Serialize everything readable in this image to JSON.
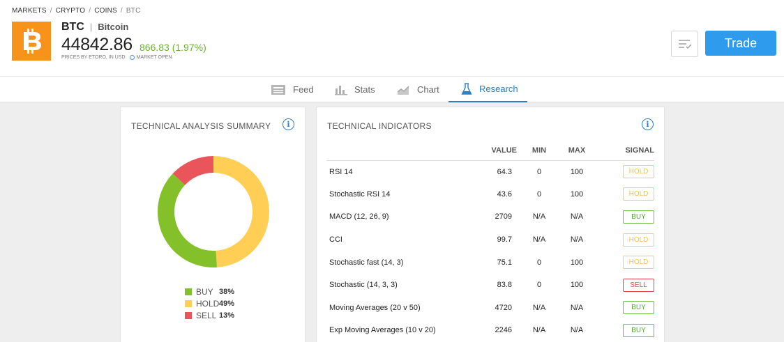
{
  "breadcrumb": [
    "MARKETS",
    "CRYPTO",
    "COINS",
    "BTC"
  ],
  "asset": {
    "symbol": "BTC",
    "name": "Bitcoin",
    "price": "44842.86",
    "change": "866.83 (1.97%)",
    "price_note": "PRICES BY ETORO, IN USD",
    "market_status": "MARKET OPEN",
    "logo_glyph": "₿",
    "logo_color": "#f7931a"
  },
  "actions": {
    "trade_label": "Trade",
    "watch_icon": "list-check-icon"
  },
  "tabs": [
    {
      "label": "Feed",
      "icon": "feed-icon",
      "active": false
    },
    {
      "label": "Stats",
      "icon": "bar-chart-icon",
      "active": false
    },
    {
      "label": "Chart",
      "icon": "line-chart-icon",
      "active": false
    },
    {
      "label": "Research",
      "icon": "flask-icon",
      "active": true
    }
  ],
  "summary": {
    "title": "TECHNICAL ANALYSIS SUMMARY",
    "legend": [
      {
        "label": "BUY",
        "pct": "38%",
        "color": "#83c02a"
      },
      {
        "label": "HOLD",
        "pct": "49%",
        "color": "#ffce54"
      },
      {
        "label": "SELL",
        "pct": "13%",
        "color": "#e9555b"
      }
    ]
  },
  "chart_data": {
    "type": "pie",
    "donut": true,
    "categories": [
      "HOLD",
      "BUY",
      "SELL"
    ],
    "values": [
      49,
      38,
      13
    ],
    "colors": [
      "#ffce54",
      "#83c02a",
      "#e9555b"
    ]
  },
  "indicators": {
    "title": "TECHNICAL INDICATORS",
    "headers": {
      "value": "VALUE",
      "min": "MIN",
      "max": "MAX",
      "signal": "SIGNAL"
    },
    "rows": [
      {
        "name": "RSI 14",
        "value": "64.3",
        "min": "0",
        "max": "100",
        "signal": "HOLD"
      },
      {
        "name": "Stochastic RSI 14",
        "value": "43.6",
        "min": "0",
        "max": "100",
        "signal": "HOLD"
      },
      {
        "name": "MACD (12, 26, 9)",
        "value": "2709",
        "min": "N/A",
        "max": "N/A",
        "signal": "BUY"
      },
      {
        "name": "CCI",
        "value": "99.7",
        "min": "N/A",
        "max": "N/A",
        "signal": "HOLD"
      },
      {
        "name": "Stochastic fast (14, 3)",
        "value": "75.1",
        "min": "0",
        "max": "100",
        "signal": "HOLD"
      },
      {
        "name": "Stochastic (14, 3, 3)",
        "value": "83.8",
        "min": "0",
        "max": "100",
        "signal": "SELL"
      },
      {
        "name": "Moving Averages (20 v 50)",
        "value": "4720",
        "min": "N/A",
        "max": "N/A",
        "signal": "BUY"
      },
      {
        "name": "Exp Moving Averages (10 v 20)",
        "value": "2246",
        "min": "N/A",
        "max": "N/A",
        "signal": "BUY"
      }
    ]
  }
}
